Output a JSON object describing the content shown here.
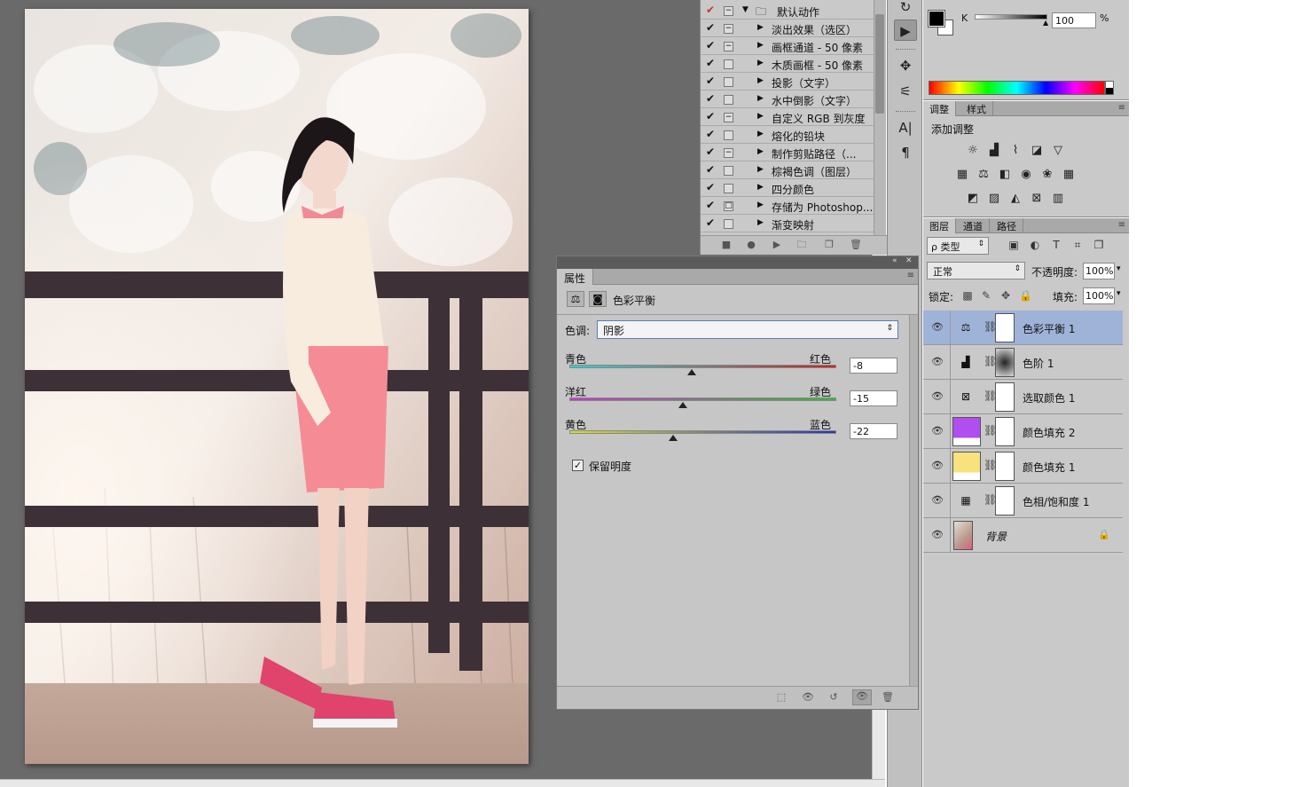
{
  "actions_panel": {
    "rows": [
      {
        "checked": true,
        "check_color": "#c0392b",
        "box": "minus",
        "expander": "down",
        "folder": true,
        "label": "默认动作"
      },
      {
        "checked": true,
        "box": "minus",
        "expander": "right",
        "label": "淡出效果（选区）"
      },
      {
        "checked": true,
        "box": "minus",
        "expander": "right",
        "label": "画框通道 - 50 像素"
      },
      {
        "checked": true,
        "box": "empty",
        "expander": "right",
        "label": "木质画框 - 50 像素"
      },
      {
        "checked": true,
        "box": "empty",
        "expander": "right",
        "label": "投影（文字）"
      },
      {
        "checked": true,
        "box": "empty",
        "expander": "right",
        "label": "水中倒影（文字）"
      },
      {
        "checked": true,
        "box": "minus",
        "expander": "right",
        "label": "自定义 RGB 到灰度"
      },
      {
        "checked": true,
        "box": "empty",
        "expander": "right",
        "label": "熔化的铅块"
      },
      {
        "checked": true,
        "box": "minus",
        "expander": "right",
        "label": "制作剪贴路径（..."
      },
      {
        "checked": true,
        "box": "empty",
        "expander": "right",
        "label": "棕褐色调（图层）"
      },
      {
        "checked": true,
        "box": "empty",
        "expander": "right",
        "label": "四分颜色"
      },
      {
        "checked": true,
        "box": "square",
        "expander": "right",
        "label": "存储为 Photoshop..."
      },
      {
        "checked": true,
        "box": "empty",
        "expander": "right",
        "label": "渐变映射"
      }
    ]
  },
  "properties_panel": {
    "tab_label": "属性",
    "header_title": "色彩平衡",
    "tone_label": "色调:",
    "tone_value": "阴影",
    "sliders": [
      {
        "left": "青色",
        "right": "红色",
        "value": "-8",
        "fraction": 0.46,
        "gradient": [
          "#33d0d0",
          "#cc2222"
        ]
      },
      {
        "left": "洋红",
        "right": "绿色",
        "value": "-15",
        "fraction": 0.425,
        "gradient": [
          "#cc33cc",
          "#33bb33"
        ]
      },
      {
        "left": "黄色",
        "right": "蓝色",
        "value": "-22",
        "fraction": 0.39,
        "gradient": [
          "#dddd22",
          "#2233cc"
        ]
      }
    ],
    "preserve_label": "保留明度",
    "preserve_checked": true
  },
  "color_panel": {
    "channel_label": "K",
    "value": "100",
    "unit": "%"
  },
  "adjustments_panel": {
    "tabs": [
      "调整",
      "样式"
    ],
    "title": "添加调整"
  },
  "layers_panel": {
    "tabs": [
      "图层",
      "通道",
      "路径"
    ],
    "filter_label": "ρ 类型",
    "blend_mode": "正常",
    "opacity_label": "不透明度:",
    "opacity_value": "100%",
    "lock_label": "锁定:",
    "fill_label": "填充:",
    "fill_value": "100%",
    "layers": [
      {
        "name": "色彩平衡 1",
        "kind": "color-balance",
        "selected": true
      },
      {
        "name": "色阶 1",
        "kind": "levels",
        "selected": false
      },
      {
        "name": "选取颜色 1",
        "kind": "selective-color",
        "selected": false
      },
      {
        "name": "颜色填充 2",
        "kind": "fill",
        "fill_color": "#b04ef0",
        "selected": false
      },
      {
        "name": "颜色填充 1",
        "kind": "fill",
        "fill_color": "#f7e27e",
        "selected": false
      },
      {
        "name": "色相/饱和度 1",
        "kind": "hue-saturation",
        "selected": false
      },
      {
        "name": "背景",
        "kind": "background",
        "selected": false,
        "locked": true
      }
    ]
  }
}
